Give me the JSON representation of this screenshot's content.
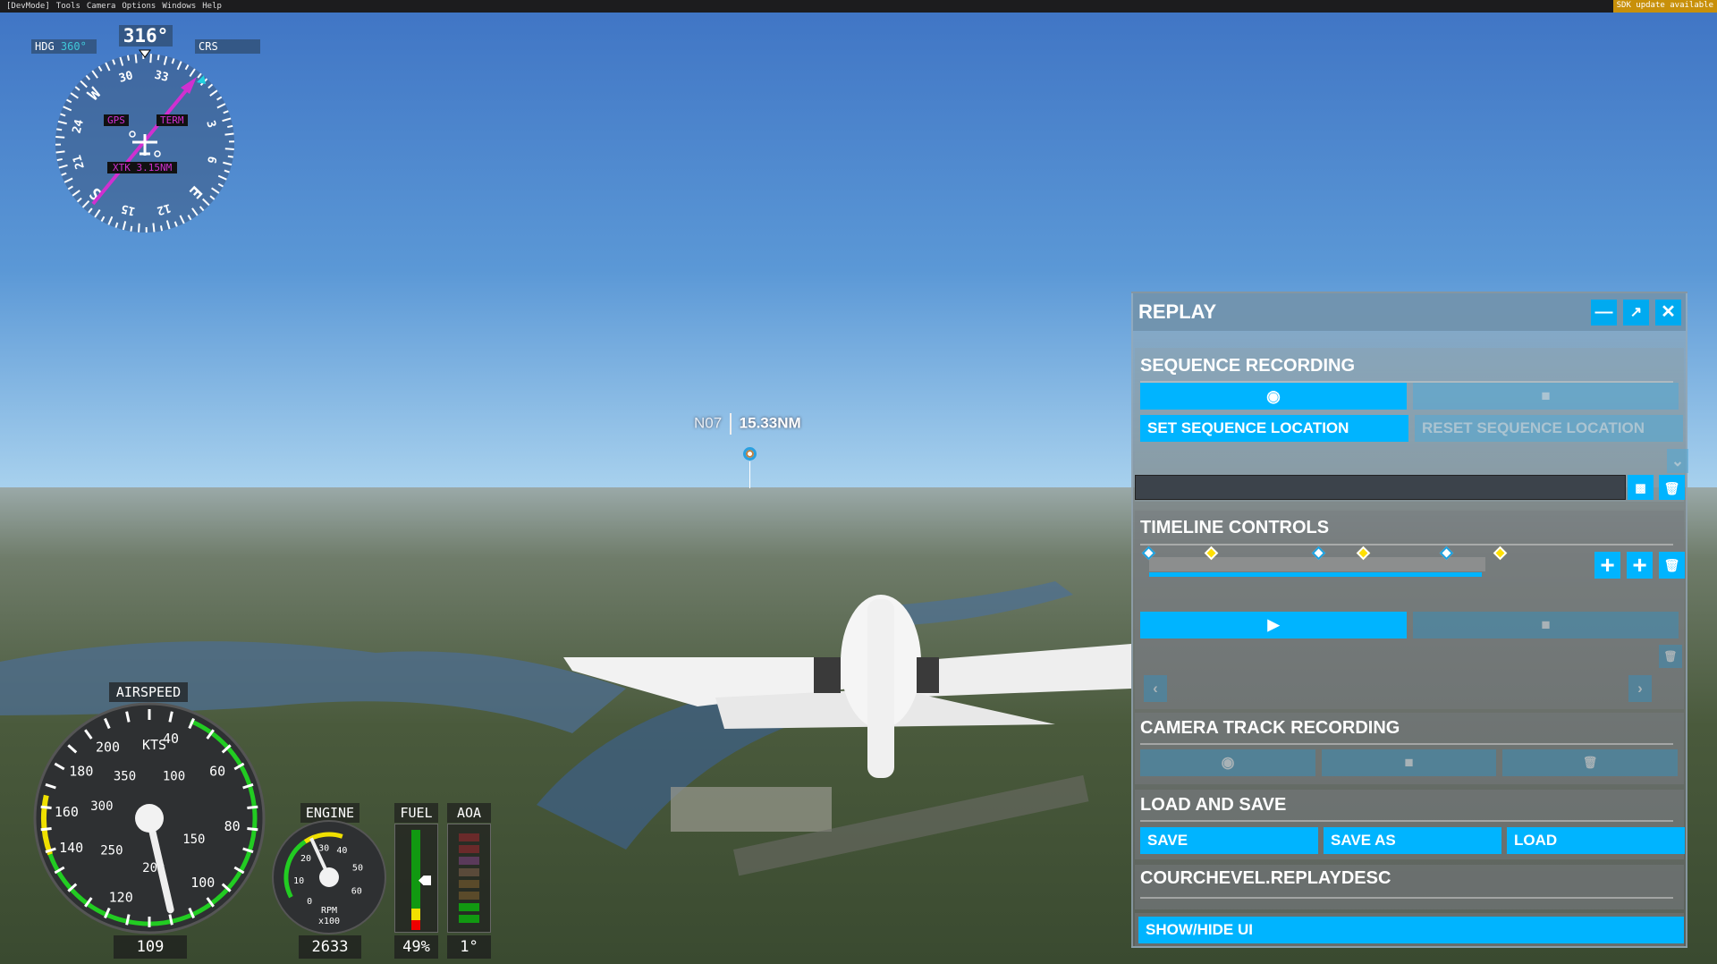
{
  "menu": {
    "items": [
      "[DevMode]",
      "Tools",
      "Camera",
      "Options",
      "Windows",
      "Help"
    ],
    "sdk_notice": "SDK update available"
  },
  "compass": {
    "heading": "316°",
    "hdg_label": "HDG",
    "hdg_value": "360°",
    "crs_label": "CRS",
    "gps": "GPS",
    "term": "TERM",
    "xtk": "XTK 3.15NM",
    "card": [
      "30",
      "33",
      "3",
      "6",
      "E",
      "12",
      "15",
      "S",
      "21",
      "24",
      "W"
    ]
  },
  "waypoint": {
    "id": "N07",
    "distance": "15.33NM"
  },
  "airspeed": {
    "title": "AIRSPEED",
    "units": "KTS",
    "value": "109",
    "outer_labels": [
      "40",
      "60",
      "80",
      "100",
      "120",
      "140",
      "160",
      "180",
      "200"
    ],
    "inner_labels": [
      "100",
      "150",
      "200",
      "250",
      "300",
      "350"
    ]
  },
  "engine": {
    "title": "ENGINE",
    "labels": [
      "0",
      "10",
      "20",
      "30",
      "40",
      "50",
      "60"
    ],
    "rpm_label": "RPM",
    "rpm_scale": "x100",
    "value": "2633"
  },
  "fuel": {
    "title": "FUEL",
    "value": "49%",
    "fraction": 0.49
  },
  "aoa": {
    "title": "AOA",
    "value": "1°"
  },
  "replay": {
    "title": "REPLAY",
    "sequence": {
      "title": "SEQUENCE RECORDING",
      "set_location": "SET SEQUENCE LOCATION",
      "reset_location": "RESET SEQUENCE LOCATION",
      "name_value": ""
    },
    "timeline": {
      "title": "TIMELINE CONTROLS",
      "progress": 0.99
    },
    "camera": {
      "title": "CAMERA TRACK RECORDING"
    },
    "loadsave": {
      "title": "LOAD AND SAVE",
      "save": "SAVE",
      "save_as": "SAVE AS",
      "load": "LOAD"
    },
    "file": {
      "name": "COURCHEVEL.REPLAYDESC"
    },
    "show_hide": "SHOW/HIDE UI"
  },
  "colors": {
    "accent": "#00b4ff",
    "gps_magenta": "#d030d0",
    "bug_cyan": "#20d0e0"
  }
}
